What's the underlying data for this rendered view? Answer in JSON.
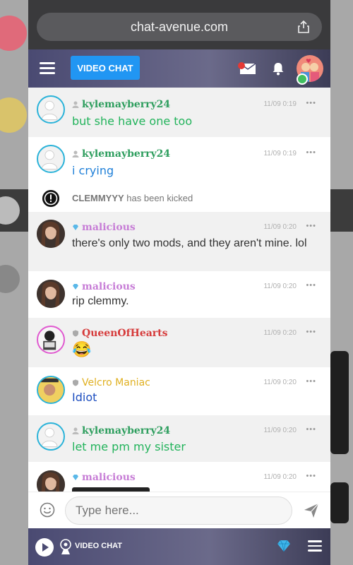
{
  "browser": {
    "url": "chat-avenue.com"
  },
  "header": {
    "video_chat_label": "VIDEO CHAT"
  },
  "messages": [
    {
      "user": "kylemayberry24",
      "rank": "user",
      "time": "11/09 0:19",
      "text": "but she have one too",
      "name_color": "#2e9e5e",
      "text_color": "#22b35b",
      "avatar": "default"
    },
    {
      "user": "kylemayberry24",
      "rank": "user",
      "time": "11/09 0:19",
      "text": "i crying",
      "name_color": "#2e9e5e",
      "text_color": "#1e7fd8",
      "avatar": "default"
    },
    {
      "user": "malicious",
      "rank": "vip",
      "time": "11/09 0:20",
      "text": "there's only two mods, and they aren't mine. lol",
      "name_color": "#c77dd6",
      "text_color": "#333333",
      "avatar": "photo"
    },
    {
      "user": "malicious",
      "rank": "vip",
      "time": "11/09 0:20",
      "text": "rip clemmy.",
      "name_color": "#c77dd6",
      "text_color": "#333333",
      "avatar": "photo"
    },
    {
      "user": "QueenOfHearts",
      "rank": "shield",
      "time": "11/09 0:20",
      "text": "😂",
      "name_color": "#d63b3b",
      "text_color": "#333333",
      "avatar": "queen"
    },
    {
      "user": "Velcro Maniac",
      "rank": "shield",
      "time": "11/09 0:20",
      "text": "Idiot",
      "name_color": "#e0b020",
      "text_color": "#1e4fc0",
      "avatar": "velcro"
    },
    {
      "user": "kylemayberry24",
      "rank": "user",
      "time": "11/09 0:20",
      "text": "let me pm my sister",
      "name_color": "#2e9e5e",
      "text_color": "#22b35b",
      "avatar": "default"
    },
    {
      "user": "malicious",
      "rank": "vip",
      "time": "11/09 0:20",
      "text": "",
      "name_color": "#c77dd6",
      "text_color": "#333333",
      "avatar": "photo"
    }
  ],
  "system": {
    "user": "CLEMMYYY",
    "text": "has been kicked"
  },
  "composer": {
    "placeholder": "Type here..."
  },
  "footer": {
    "video_chat_label": "VIDEO CHAT"
  },
  "colors": {
    "accent": "#2196f3",
    "online": "#3fbf5f"
  }
}
